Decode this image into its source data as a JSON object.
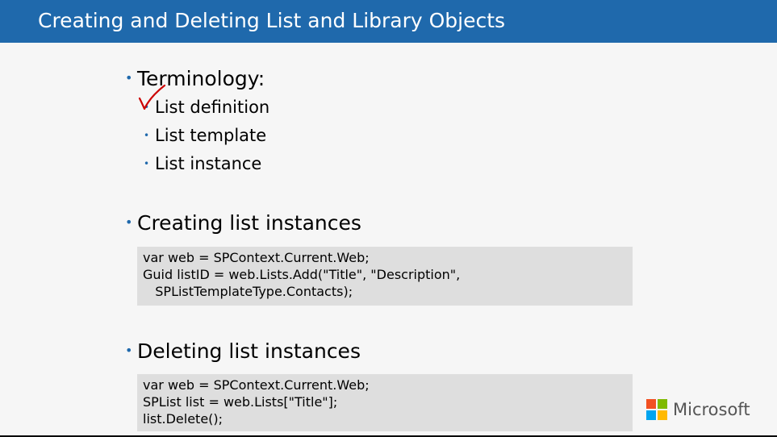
{
  "slide": {
    "title": "Creating and Deleting List and Library Objects"
  },
  "bullets": {
    "terminology": {
      "label": "Terminology:",
      "items": [
        "List definition",
        "List template",
        "List instance"
      ]
    },
    "creating": {
      "label": "Creating list instances",
      "code": "var web = SPContext.Current.Web;\nGuid listID = web.Lists.Add(\"Title\", \"Description\",\n   SPListTemplateType.Contacts);"
    },
    "deleting": {
      "label": "Deleting list instances",
      "code": "var web = SPContext.Current.Web;\nSPList list = web.Lists[\"Title\"];\nlist.Delete();"
    }
  },
  "brand": {
    "name": "Microsoft",
    "logo_colors": [
      "#f25022",
      "#7fba00",
      "#00a4ef",
      "#ffb900"
    ]
  },
  "colors": {
    "title_bar": "#1f69ac",
    "bullet": "#1f69ac",
    "code_bg": "#dedede",
    "annotation": "#cc0000"
  },
  "annotations": {
    "icon": "checkmark-icon"
  }
}
